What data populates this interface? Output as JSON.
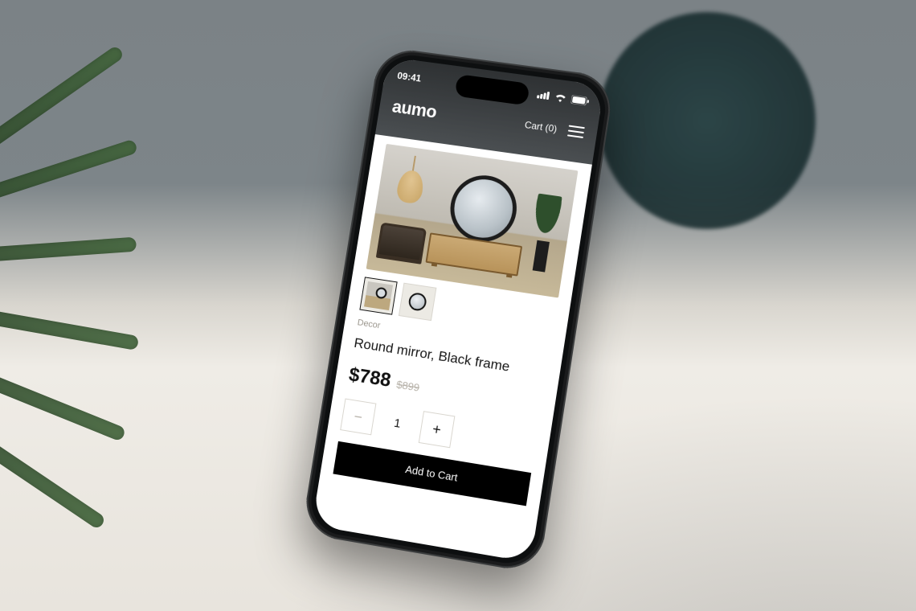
{
  "status": {
    "time": "09:41"
  },
  "header": {
    "brand": "aumo",
    "cart_label": "Cart (0)"
  },
  "product": {
    "category": "Decor",
    "title": "Round mirror, Black frame",
    "price": "$788",
    "compare_price": "$899",
    "quantity": "1",
    "add_to_cart_label": "Add to Cart"
  }
}
